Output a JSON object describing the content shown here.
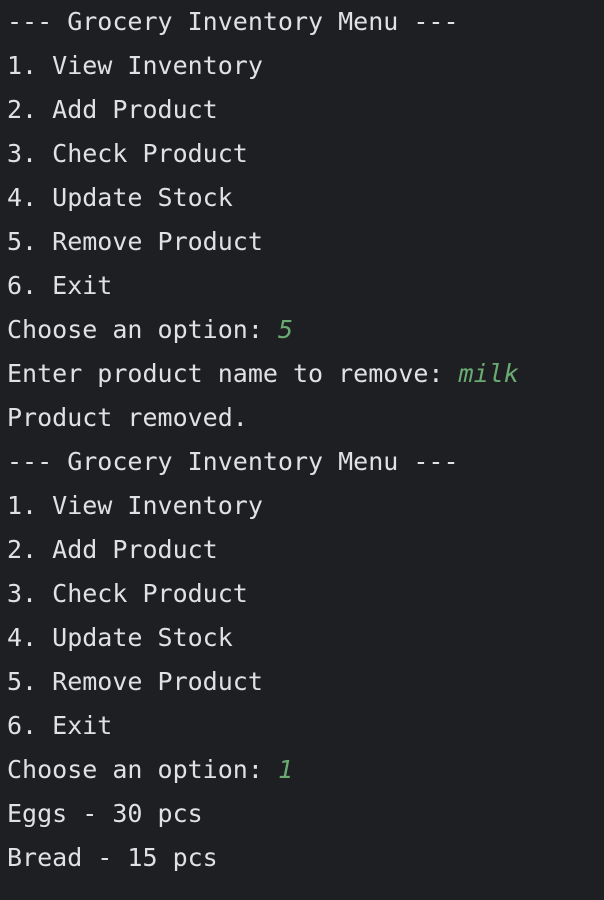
{
  "console": {
    "lines": [
      "--- Grocery Inventory Menu ---",
      "1. View Inventory",
      "2. Add Product",
      "3. Check Product",
      "4. Update Stock",
      "5. Remove Product",
      "6. Exit",
      "Choose an option: ",
      "Enter product name to remove: ",
      "Product removed.",
      "--- Grocery Inventory Menu ---",
      "1. View Inventory",
      "2. Add Product",
      "3. Check Product",
      "4. Update Stock",
      "5. Remove Product",
      "6. Exit",
      "Choose an option: ",
      "Eggs - 30 pcs",
      "Bread - 15 pcs"
    ],
    "inputs": {
      "7": "5",
      "8": "milk",
      "17": "1"
    }
  },
  "colors": {
    "background": "#1e1f22",
    "text": "#dfe1e5",
    "user_input": "#6aab73"
  }
}
